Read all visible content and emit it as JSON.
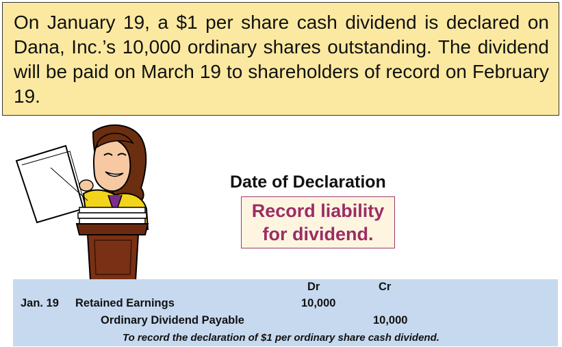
{
  "problem": {
    "text": "On January 19, a $1 per share cash dividend is declared on Dana, Inc.’s 10,000 ordinary shares outstanding. The dividend will be paid on March 19 to shareholders of record on February 19."
  },
  "declaration": {
    "title": "Date of Declaration",
    "note_line1": "Record liability",
    "note_line2": "for dividend."
  },
  "journal": {
    "dr_header": "Dr",
    "cr_header": "Cr",
    "entries": [
      {
        "date": "Jan. 19",
        "account": "Retained Earnings",
        "debit": "10,000"
      },
      {
        "account": "Ordinary Dividend Payable",
        "credit": "10,000"
      }
    ],
    "memo": "To record the declaration of $1 per ordinary share cash dividend."
  },
  "colors": {
    "problem_bg": "#fbe9a1",
    "note_text": "#9b2d63",
    "journal_bg": "#c6d9ef"
  }
}
